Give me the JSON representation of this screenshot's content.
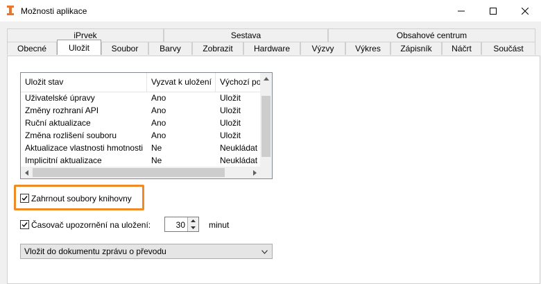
{
  "window": {
    "title": "Možnosti aplikace",
    "controls": [
      "minimize-icon",
      "maximize-icon",
      "close-icon"
    ]
  },
  "tabs": {
    "row1": [
      "iPrvek",
      "Sestava",
      "Obsahové centrum"
    ],
    "row2": [
      "Obecné",
      "Uložit",
      "Soubor",
      "Barvy",
      "Zobrazit",
      "Hardware",
      "Výzvy",
      "Výkres",
      "Zápisník",
      "Náčrt",
      "Součást"
    ],
    "active": "Uložit"
  },
  "save_list": {
    "columns": [
      "Uložit stav",
      "Vyzvat k uložení",
      "Výchozí po"
    ],
    "rows": [
      [
        "Uživatelské úpravy",
        "Ano",
        "Uložit"
      ],
      [
        "Změny rozhraní API",
        "Ano",
        "Uložit"
      ],
      [
        "Ruční aktualizace",
        "Ano",
        "Uložit"
      ],
      [
        "Změna rozlišení souboru",
        "Ano",
        "Uložit"
      ],
      [
        "Aktualizace vlastnosti hmotnosti",
        "Ne",
        "Neukládat"
      ],
      [
        "Implicitní aktualizace",
        "Ne",
        "Neukládat"
      ]
    ]
  },
  "include_library": {
    "label": "Zahrnout soubory knihovny",
    "checked": true
  },
  "autosave": {
    "label": "Časovač upozornění na uložení:",
    "checked": true,
    "value": "30",
    "unit": "minut"
  },
  "conversion_dropdown": {
    "selected": "Vložit do dokumentu zprávu o převodu"
  },
  "colors": {
    "highlight": "#f08a24",
    "app_icon": "#e8762c"
  }
}
